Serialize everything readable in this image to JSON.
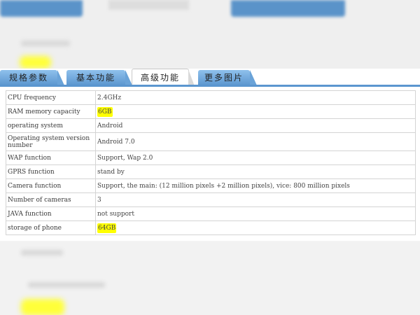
{
  "tabs": [
    {
      "label": "规格参数",
      "active": false
    },
    {
      "label": "基本功能",
      "active": false
    },
    {
      "label": "高级功能",
      "active": true
    },
    {
      "label": "更多图片",
      "active": false
    }
  ],
  "specs": [
    {
      "key": "CPU frequency",
      "value": "2.4GHz",
      "highlight": false
    },
    {
      "key": "RAM memory capacity",
      "value": "6GB",
      "highlight": true
    },
    {
      "key": "operating system",
      "value": "Android",
      "highlight": false
    },
    {
      "key": "Operating system version number",
      "value": "Android 7.0",
      "highlight": false
    },
    {
      "key": "WAP function",
      "value": "Support, Wap 2.0",
      "highlight": false
    },
    {
      "key": "GPRS function",
      "value": "stand by",
      "highlight": false
    },
    {
      "key": "Camera function",
      "value": "Support, the main: (12 million pixels +2 million pixels), vice: 800 million pixels",
      "highlight": false
    },
    {
      "key": "Number of cameras",
      "value": "3",
      "highlight": false
    },
    {
      "key": "JAVA function",
      "value": "not support",
      "highlight": false
    },
    {
      "key": "storage of phone",
      "value": "64GB",
      "highlight": true
    }
  ],
  "colors": {
    "tab_blue": "#5b96cf",
    "highlight": "#ffff00"
  }
}
